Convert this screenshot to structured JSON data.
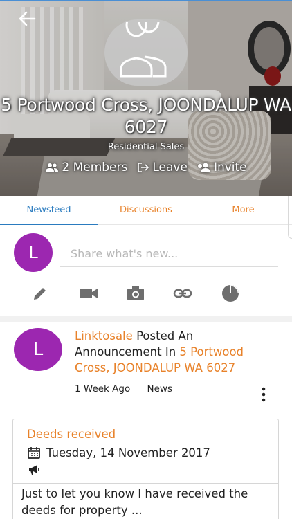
{
  "group": {
    "address": "5 Portwood Cross, JOONDALUP WA 6027",
    "category": "Residential Sales",
    "members_label": "2 Members",
    "leave_label": "Leave",
    "invite_label": "Invite"
  },
  "tabs": {
    "newsfeed": "Newsfeed",
    "discussions": "Discussions",
    "more": "More"
  },
  "composer": {
    "avatar_letter": "L",
    "placeholder": "Share what's new..."
  },
  "tools": [
    "pencil-icon",
    "video-icon",
    "camera-icon",
    "link-icon",
    "poll-icon"
  ],
  "post": {
    "avatar_letter": "L",
    "author": "Linktosale",
    "action": "Posted An Announcement In",
    "group_link": "5 Portwood Cross, JOONDALUP WA 6027",
    "time": "1 Week Ago",
    "tag": "News"
  },
  "announcement": {
    "title": "Deeds received",
    "date": "Tuesday, 14 November 2017",
    "body": "Just to let you know I have received the deeds for property ..."
  },
  "colors": {
    "accent_orange": "#e8822a",
    "accent_blue": "#2a7bbf",
    "avatar_purple": "#9c27b0"
  }
}
